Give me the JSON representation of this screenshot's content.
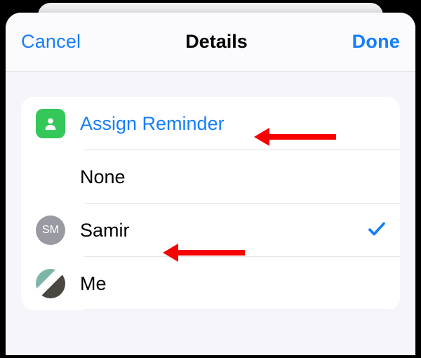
{
  "nav": {
    "cancel": "Cancel",
    "title": "Details",
    "done": "Done"
  },
  "assign": {
    "label": "Assign Reminder"
  },
  "options": {
    "none": "None",
    "samir": {
      "label": "Samir",
      "initials": "SM",
      "selected": true
    },
    "me": {
      "label": "Me"
    }
  }
}
